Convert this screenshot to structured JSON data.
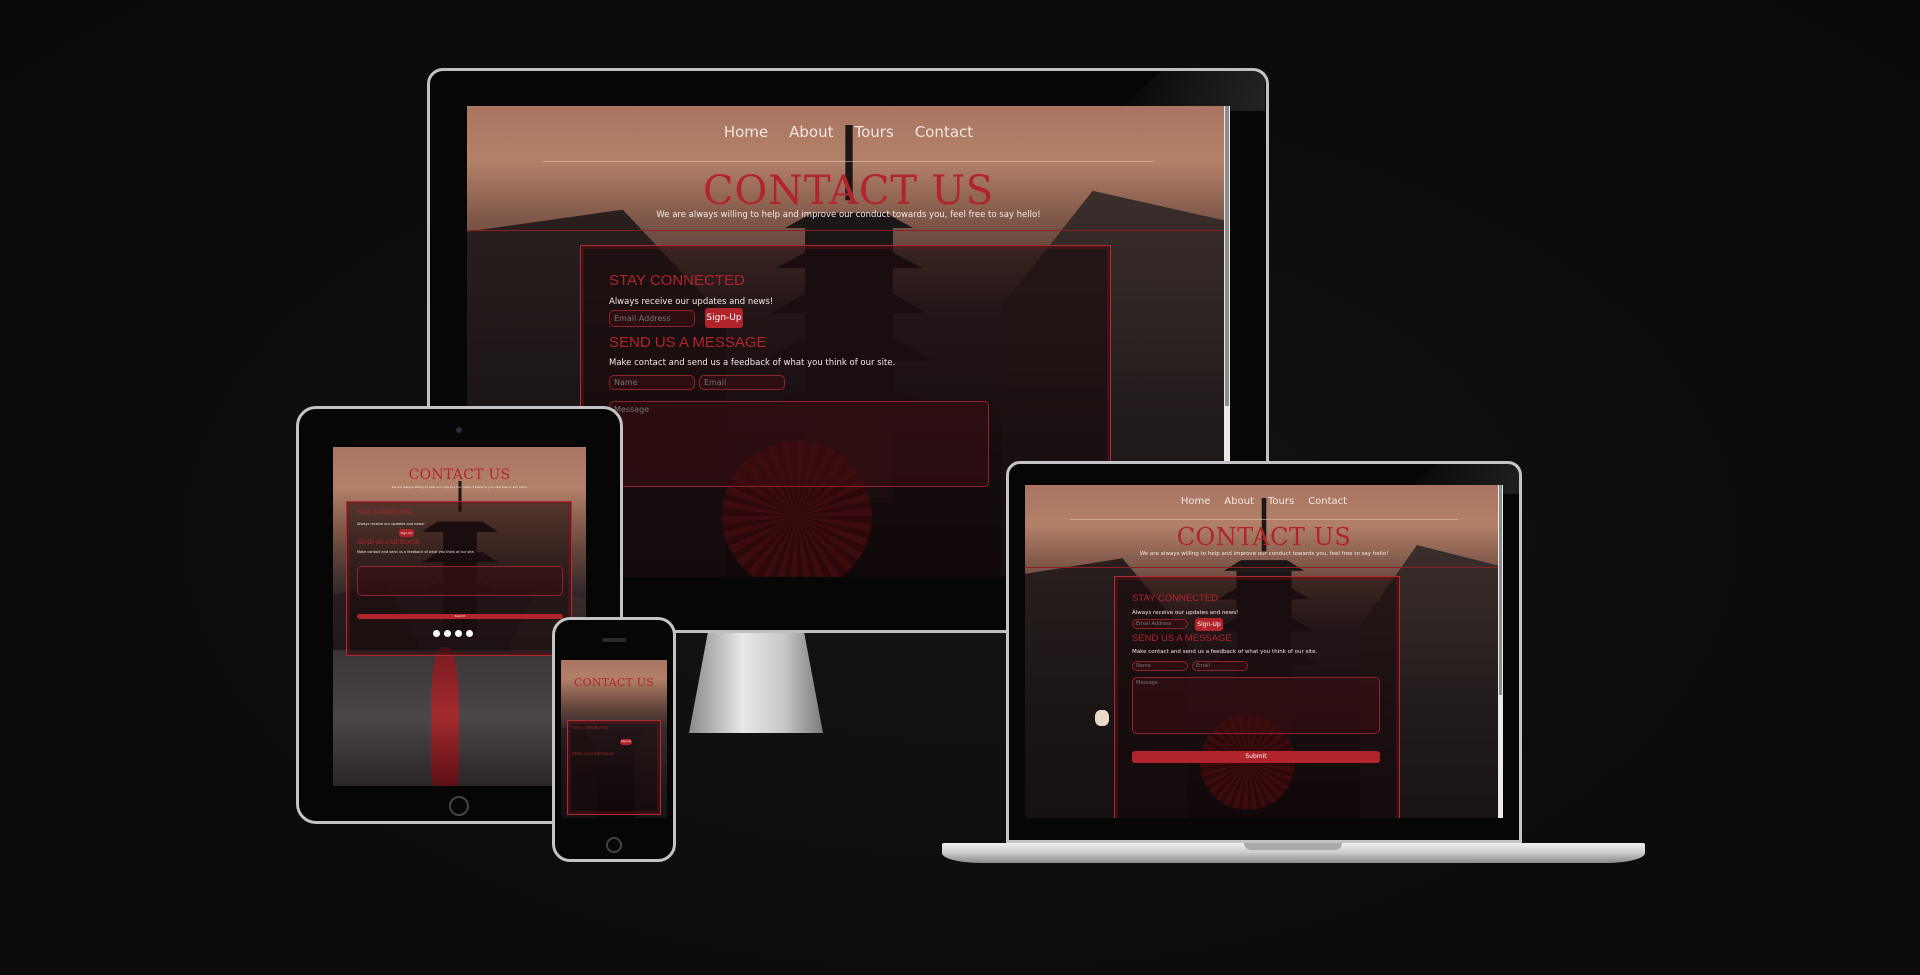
{
  "nav": {
    "home": "Home",
    "about": "About",
    "tours": "Tours",
    "contact": "Contact"
  },
  "hero": {
    "title": "CONTACT US",
    "subtitle": "We are always willing to help and improve our conduct towards you, feel free to say hello!"
  },
  "newsletter": {
    "heading": "STAY CONNECTED",
    "text": "Always receive our updates and news!",
    "email_placeholder": "Email Address",
    "button": "Sign-Up"
  },
  "message": {
    "heading": "SEND US A MESSAGE",
    "text": "Make contact and send us a feedback of what you think of our site.",
    "name_placeholder": "Name",
    "email_placeholder": "Email",
    "message_placeholder": "Message",
    "submit": "Submit"
  },
  "colors": {
    "accent": "#b2242c",
    "background": "#0d0c0d",
    "panel_border": "#b22a32"
  },
  "icons": [
    "facebook-icon",
    "twitter-icon",
    "instagram-icon",
    "whatsapp-icon"
  ]
}
